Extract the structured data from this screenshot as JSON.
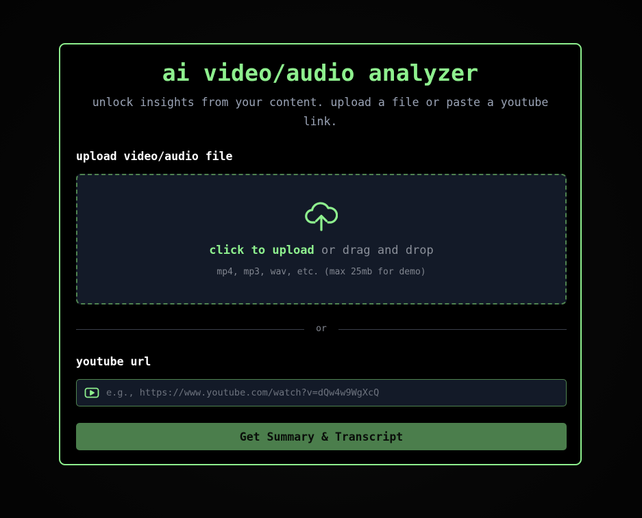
{
  "header": {
    "title": "ai video/audio analyzer",
    "subtitle": "unlock insights from your content. upload a file or paste a youtube link."
  },
  "upload": {
    "label": "upload video/audio file",
    "icon": "cloud-upload-icon",
    "click_text": "click to upload",
    "drag_text": "or drag and drop",
    "hint": "mp4, mp3, wav, etc. (max 25mb for demo)"
  },
  "divider": {
    "text": "or"
  },
  "youtube": {
    "label": "youtube url",
    "icon": "youtube-play-icon",
    "placeholder": "e.g., https://www.youtube.com/watch?v=dQw4w9WgXcQ",
    "value": ""
  },
  "actions": {
    "submit_label": "Get Summary & Transcript"
  },
  "colors": {
    "accent": "#8ef08e",
    "button_bg": "#4b7e4c",
    "panel_bg": "#131a28",
    "page_bg": "#000000",
    "muted_text": "#9aa3b5"
  }
}
